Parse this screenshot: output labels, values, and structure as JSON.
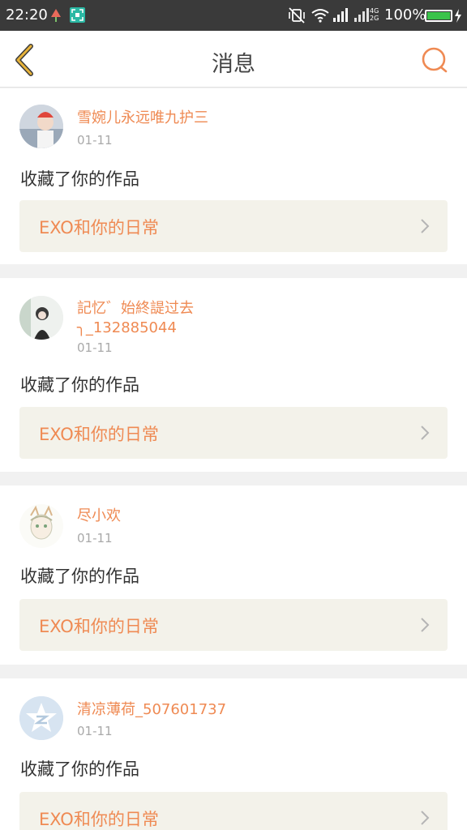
{
  "status_bar": {
    "time": "22:20",
    "network": "4G\n2G",
    "battery": "100%",
    "battery_color": "#3ac34a"
  },
  "header": {
    "title": "消息",
    "accent_color": "#ef8a53",
    "back_icon_color": "#e7b33a"
  },
  "messages": [
    {
      "user": "雪婉儿永远唯九护三",
      "date": "01-11",
      "action": "收藏了你的作品",
      "work": "EXO和你的日常"
    },
    {
      "user": "記忆゛始終諟过去\n╮_132885044",
      "date": "01-11",
      "action": "收藏了你的作品",
      "work": "EXO和你的日常"
    },
    {
      "user": "尽小欢",
      "date": "01-11",
      "action": "收藏了你的作品",
      "work": "EXO和你的日常"
    },
    {
      "user": "清凉薄荷_507601737",
      "date": "01-11",
      "action": "收藏了你的作品",
      "work": "EXO和你的日常"
    }
  ]
}
